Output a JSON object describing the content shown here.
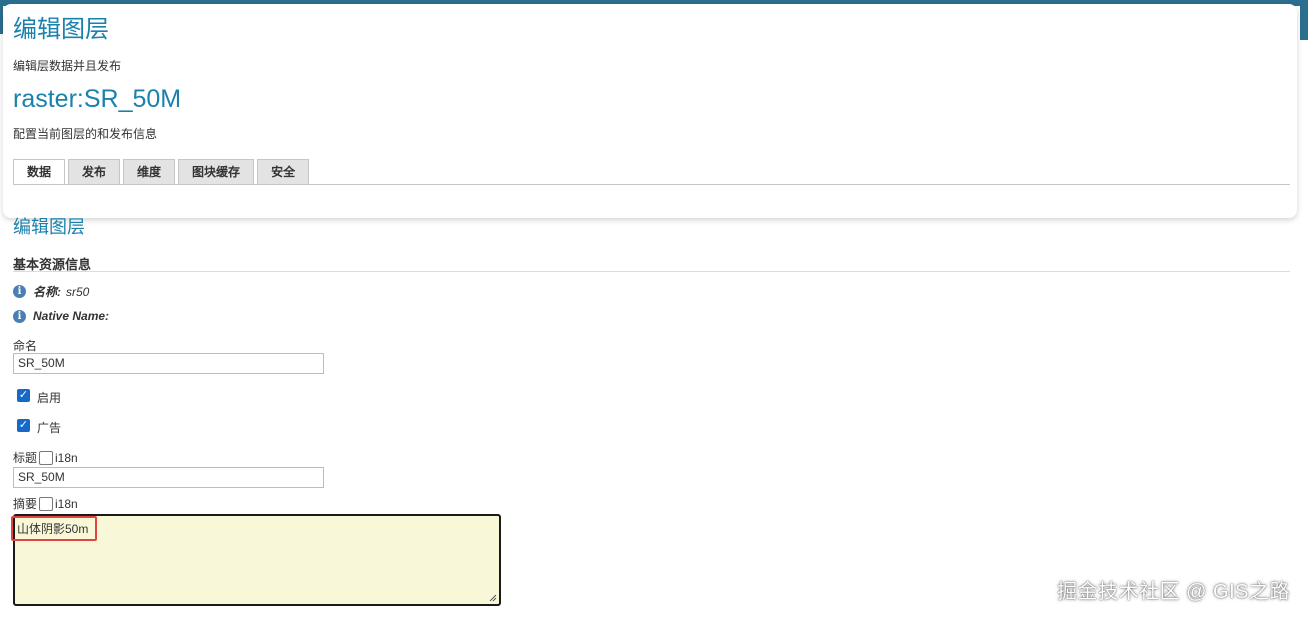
{
  "header": {
    "title": "编辑图层",
    "subtitle": "编辑层数据并且发布",
    "layer_name": "raster:SR_50M",
    "layer_desc": "配置当前图层的和发布信息"
  },
  "tabs": [
    {
      "label": "数据",
      "active": true
    },
    {
      "label": "发布",
      "active": false
    },
    {
      "label": "维度",
      "active": false
    },
    {
      "label": "图块缓存",
      "active": false
    },
    {
      "label": "安全",
      "active": false
    }
  ],
  "section": {
    "title": "编辑图层",
    "basic_info_title": "基本资源信息"
  },
  "info": {
    "name_key": "名称:",
    "name_value": "sr50",
    "native_key": "Native Name:",
    "native_value": ""
  },
  "form": {
    "name_label": "命名",
    "name_value": "SR_50M",
    "enabled_label": "启用",
    "enabled_checked": true,
    "advertised_label": "广告",
    "advertised_checked": true,
    "title_label": "标题",
    "title_i18n": "i18n",
    "title_value": "SR_50M",
    "abstract_label": "摘要",
    "abstract_i18n": "i18n",
    "abstract_value": "山体阴影50m"
  },
  "watermark": "掘金技术社区 @ GIS之路",
  "colors": {
    "accent": "#1a81ad",
    "topbar": "#2b6f8e",
    "highlight": "#e0463f",
    "textarea_bg": "#f8f8d8"
  }
}
